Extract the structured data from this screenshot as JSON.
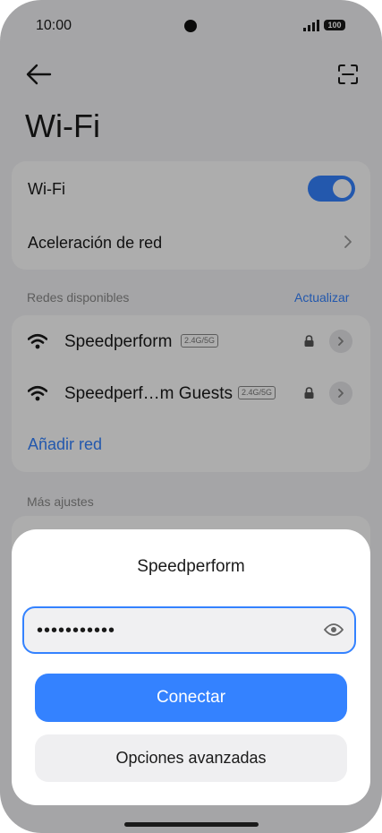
{
  "status_bar": {
    "time": "10:00",
    "battery": "100"
  },
  "header": {
    "title": "Wi-Fi"
  },
  "settings_card": {
    "wifi_label": "Wi-Fi",
    "wifi_enabled": true,
    "network_acceleration_label": "Aceleración de red"
  },
  "available_networks": {
    "section_label": "Redes disponibles",
    "refresh_label": "Actualizar",
    "networks": [
      {
        "name": "Speedperform",
        "band": "2.4G/5G",
        "secured": true,
        "icon": "wifi-icon"
      },
      {
        "name": "Speedperf…m Guests",
        "band": "2.4G/5G",
        "secured": true,
        "icon": "wifi-icon"
      }
    ],
    "add_network_label": "Añadir red"
  },
  "more_settings": {
    "section_label": "Más ajustes"
  },
  "dialog": {
    "title": "Speedperform",
    "password_value": "•••••••••••",
    "connect_label": "Conectar",
    "advanced_label": "Opciones avanzadas"
  },
  "colors": {
    "accent": "#3482ff",
    "background": "#f4f4f6",
    "card": "#ffffff"
  }
}
